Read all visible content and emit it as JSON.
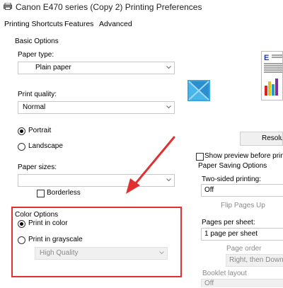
{
  "window": {
    "title": "Canon E470 series (Copy 2) Printing Preferences"
  },
  "tabs": [
    {
      "label": "Printing Shortcuts"
    },
    {
      "label": "Features"
    },
    {
      "label": "Advanced"
    }
  ],
  "basic_options": {
    "heading": "Basic Options",
    "paper_type_label": "Paper type:",
    "paper_type_value": "Plain paper",
    "print_quality_label": "Print quality:",
    "print_quality_value": "Normal",
    "portrait_label": "Portrait",
    "landscape_label": "Landscape",
    "orientation_selected": "Portrait",
    "paper_sizes_label": "Paper sizes:",
    "paper_sizes_value": "",
    "borderless_label": "Borderless",
    "borderless_checked": false
  },
  "color_options": {
    "heading": "Color Options",
    "print_in_color_label": "Print in color",
    "print_in_grayscale_label": "Print in grayscale",
    "selected": "Print in color",
    "grayscale_quality_value": "High Quality"
  },
  "right_panel": {
    "resolution_button_label": "Resolu",
    "show_preview_label": "Show preview before print",
    "show_preview_checked": false,
    "paper_saving_heading": "Paper Saving Options",
    "two_sided_label": "Two-sided printing:",
    "two_sided_value": "Off",
    "flip_pages_label": "Flip Pages Up",
    "pages_per_sheet_label": "Pages per sheet:",
    "pages_per_sheet_value": "1 page per sheet",
    "page_order_label": "Page order",
    "page_order_value": "Right, then Down",
    "booklet_layout_label": "Booklet layout",
    "booklet_layout_value": "Off"
  },
  "annotation": {
    "color": "#e0302f"
  }
}
